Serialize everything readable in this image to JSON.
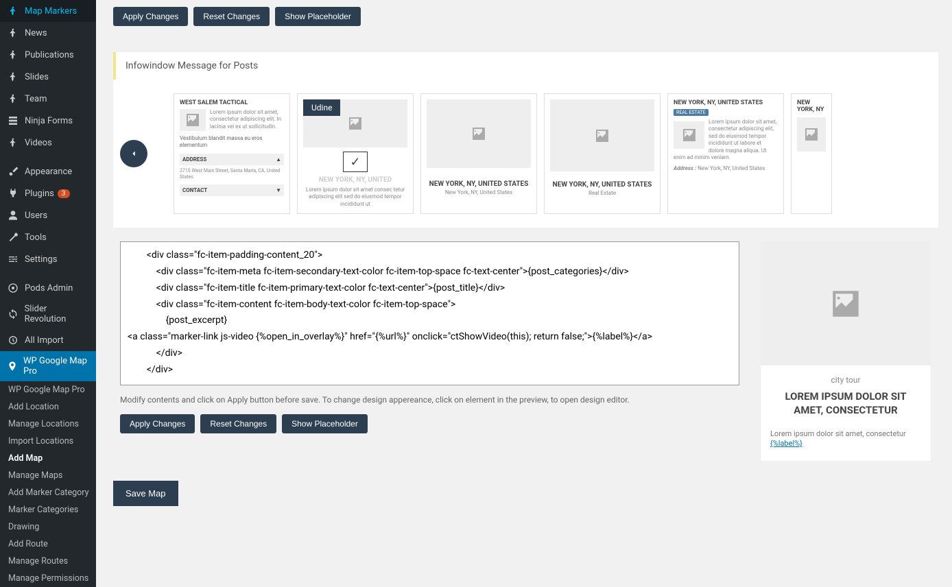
{
  "sidebar": {
    "menu": [
      {
        "label": "Map Markers",
        "icon": "pin"
      },
      {
        "label": "News",
        "icon": "pin"
      },
      {
        "label": "Publications",
        "icon": "pin"
      },
      {
        "label": "Slides",
        "icon": "pin"
      },
      {
        "label": "Team",
        "icon": "pin"
      },
      {
        "label": "Ninja Forms",
        "icon": "form"
      },
      {
        "label": "Videos",
        "icon": "pin"
      }
    ],
    "menu2": [
      {
        "label": "Appearance",
        "icon": "brush"
      },
      {
        "label": "Plugins",
        "icon": "plug",
        "badge": "3"
      },
      {
        "label": "Users",
        "icon": "user"
      },
      {
        "label": "Tools",
        "icon": "wrench"
      },
      {
        "label": "Settings",
        "icon": "slider"
      }
    ],
    "menu3": [
      {
        "label": "Pods Admin",
        "icon": "pods"
      },
      {
        "label": "Slider Revolution",
        "icon": "refresh"
      },
      {
        "label": "All Import",
        "icon": "import"
      }
    ],
    "active": {
      "label": "WP Google Map Pro"
    },
    "submenu": [
      {
        "label": "WP Google Map Pro"
      },
      {
        "label": "Add Location"
      },
      {
        "label": "Manage Locations"
      },
      {
        "label": "Import Locations"
      },
      {
        "label": "Add Map",
        "current": true
      },
      {
        "label": "Manage Maps"
      },
      {
        "label": "Add Marker Category"
      },
      {
        "label": "Marker Categories"
      },
      {
        "label": "Drawing"
      },
      {
        "label": "Add Route"
      },
      {
        "label": "Manage Routes"
      },
      {
        "label": "Manage Permissions"
      }
    ]
  },
  "buttons_top": {
    "apply": "Apply Changes",
    "reset": "Reset Changes",
    "show": "Show Placeholder"
  },
  "section_title": "Infowindow Message for Posts",
  "carousel": {
    "card1": {
      "title": "WEST SALEM TACTICAL",
      "lorem": "Lorem ipsum dolor sit amet, consectetur adipiscing elit. In lacinia vel ex ut sollicitudin.",
      "vest": "Vestibulum blandit massa eu eros elementum",
      "addr_label": "ADDRESS",
      "addr_text": "2715 West Main Street, Santa Maria, CA, United States",
      "contact_label": "CONTACT"
    },
    "card2": {
      "badge": "Udine",
      "title": "NEW YORK, NY, UNITED",
      "lorem": "Lorem ipsum dolor sit amet consec tetur adipiscing elit sed do eiusmod tempor incididunt ut"
    },
    "card3": {
      "title": "NEW YORK, NY, UNITED STATES",
      "sub": "New York, NY, United States"
    },
    "card4": {
      "title": "NEW YORK, NY, UNITED STATES",
      "sub": "Real Estate"
    },
    "card5": {
      "title": "NEW YORK, NY, UNITED STATES",
      "pill": "REAL ESTATE",
      "lorem": "Lorem ipsum dolor sit amet, consectetur adipiscing elit, sed do eiusmod tempor incididunt ut labore et dolore magna aliqua. Ut enim ad minim veniam.",
      "addr_label": "Address :",
      "addr_text": "New York, NY, United States"
    },
    "card6": {
      "title": "NEW YORK, NY"
    }
  },
  "code": "        <div class=\"fc-item-padding-content_20\">\n            <div class=\"fc-item-meta fc-item-secondary-text-color fc-item-top-space fc-text-center\">{post_categories}</div>\n            <div class=\"fc-item-title fc-item-primary-text-color fc-text-center\">{post_title}</div>\n            <div class=\"fc-item-content fc-item-body-text-color fc-item-top-space\">\n                {post_excerpt}\n<a class=\"marker-link js-video {%open_in_overlay%}\" href=\"{%url%}\" onclick=\"ctShowVideo(this); return false;\">{%label%}</a>\n            </div>\n        </div>",
  "help": "Modify contents and click on Apply button before save. To change design appereance, click on element in the preview, to open design editor.",
  "preview": {
    "category": "city tour",
    "title": "LOREM IPSUM DOLOR SIT AMET, CONSECTETUR",
    "text": "Lorem ipsum dolor sit amet, consectetur",
    "link": "{%label%}"
  },
  "save": "Save Map"
}
